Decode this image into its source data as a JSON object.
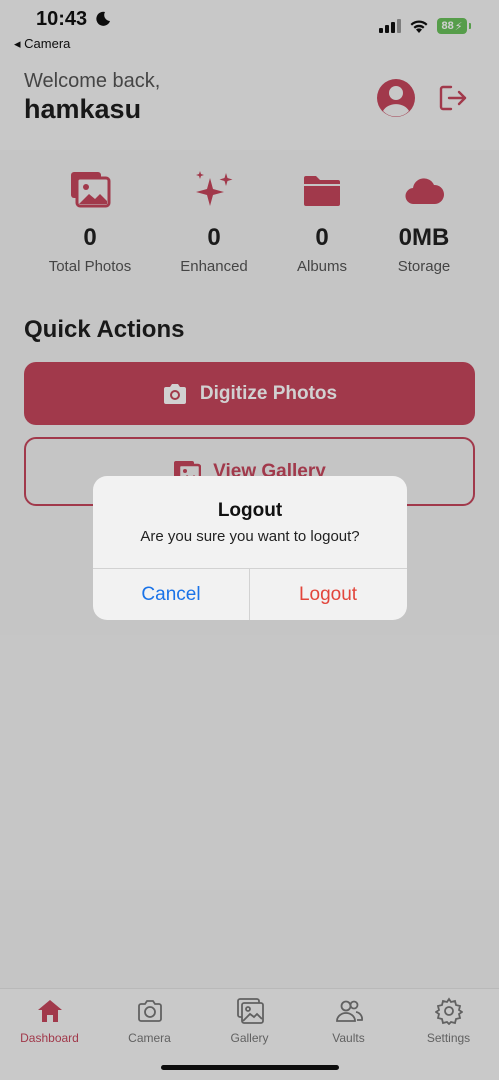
{
  "status_bar": {
    "time": "10:43",
    "back_label": "◂ Camera",
    "battery": "88"
  },
  "header": {
    "welcome": "Welcome back,",
    "username": "hamkasu"
  },
  "stats": [
    {
      "value": "0",
      "label": "Total Photos",
      "icon": "photos-icon"
    },
    {
      "value": "0",
      "label": "Enhanced",
      "icon": "sparkles-icon"
    },
    {
      "value": "0",
      "label": "Albums",
      "icon": "folder-icon"
    },
    {
      "value": "0MB",
      "label": "Storage",
      "icon": "cloud-icon"
    }
  ],
  "quick_actions": {
    "title": "Quick Actions",
    "digitize_label": "Digitize Photos",
    "gallery_label": "View Gallery"
  },
  "tabs": [
    {
      "label": "Dashboard",
      "icon": "home-icon",
      "active": true
    },
    {
      "label": "Camera",
      "icon": "camera-icon",
      "active": false
    },
    {
      "label": "Gallery",
      "icon": "gallery-icon",
      "active": false
    },
    {
      "label": "Vaults",
      "icon": "people-icon",
      "active": false
    },
    {
      "label": "Settings",
      "icon": "gear-icon",
      "active": false
    }
  ],
  "dialog": {
    "title": "Logout",
    "message": "Are you sure you want to logout?",
    "cancel_label": "Cancel",
    "confirm_label": "Logout"
  },
  "colors": {
    "accent": "#c5465c",
    "cancel": "#1a73e8",
    "destructive": "#e2453b"
  }
}
